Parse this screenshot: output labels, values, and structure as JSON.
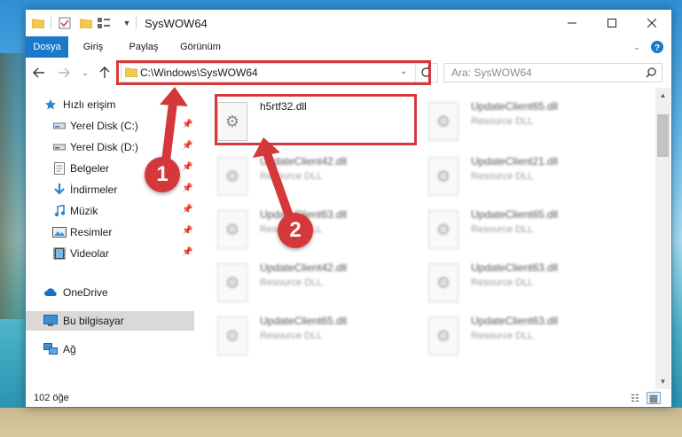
{
  "window": {
    "title": "SysWOW64"
  },
  "ribbon": {
    "tabs": [
      "Dosya",
      "Giriş",
      "Paylaş",
      "Görünüm"
    ]
  },
  "address": {
    "path": "C:\\Windows\\SysWOW64"
  },
  "search": {
    "placeholder": "Ara: SysWOW64"
  },
  "sidebar": {
    "items": [
      {
        "label": "Hızlı erişim",
        "icon": "star-icon",
        "pinned": false
      },
      {
        "label": "Yerel Disk (C:)",
        "icon": "drive-icon",
        "pinned": true
      },
      {
        "label": "Yerel Disk (D:)",
        "icon": "drive-icon",
        "pinned": true
      },
      {
        "label": "Belgeler",
        "icon": "documents-icon",
        "pinned": true
      },
      {
        "label": "İndirmeler",
        "icon": "download-icon",
        "pinned": true
      },
      {
        "label": "Müzik",
        "icon": "music-icon",
        "pinned": true
      },
      {
        "label": "Resimler",
        "icon": "pictures-icon",
        "pinned": true
      },
      {
        "label": "Videolar",
        "icon": "videos-icon",
        "pinned": true
      },
      {
        "label": "OneDrive",
        "icon": "cloud-icon",
        "pinned": false
      },
      {
        "label": "Bu bilgisayar",
        "icon": "computer-icon",
        "pinned": false,
        "selected": true
      },
      {
        "label": "Ağ",
        "icon": "network-icon",
        "pinned": false
      }
    ]
  },
  "files": [
    {
      "name": "h5rtf32.dll",
      "type": "",
      "highlighted": true
    },
    {
      "name": "UpdateClient65.dll",
      "type": "Resource DLL"
    },
    {
      "name": "UpdateClient42.dll",
      "type": "Resource DLL"
    },
    {
      "name": "UpdateClient21.dll",
      "type": "Resource DLL"
    },
    {
      "name": "UpdateClient63.dll",
      "type": "Resource DLL"
    },
    {
      "name": "UpdateClient65.dll",
      "type": "Resource DLL"
    },
    {
      "name": "UpdateClient42.dll",
      "type": "Resource DLL"
    },
    {
      "name": "UpdateClient63.dll",
      "type": "Resource DLL"
    },
    {
      "name": "UpdateClient65.dll",
      "type": "Resource DLL"
    },
    {
      "name": "UpdateClient63.dll",
      "type": "Resource DLL"
    }
  ],
  "status": {
    "item_count": "102 öğe"
  },
  "annotations": {
    "step1": "1",
    "step2": "2"
  },
  "colors": {
    "accent": "#1979ca",
    "highlight": "#d5383a",
    "selected_bg": "#d9d9d9"
  }
}
